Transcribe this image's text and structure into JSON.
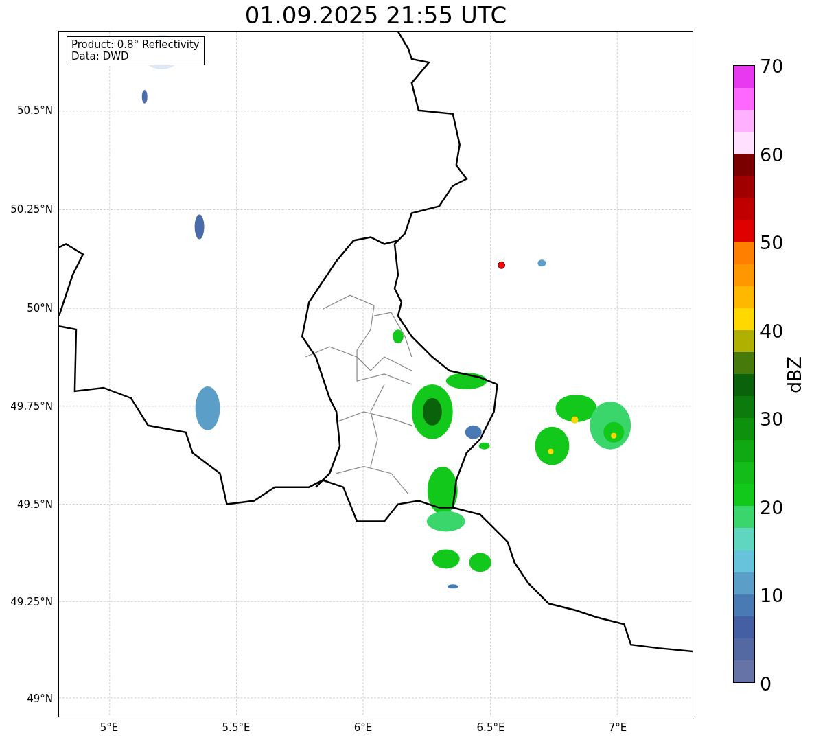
{
  "title": "01.09.2025 21:55 UTC",
  "info_box": {
    "lines": [
      "Product: 0.8° Reflectivity",
      "Data: DWD"
    ]
  },
  "map": {
    "xticks": [
      "5°E",
      "5.5°E",
      "6°E",
      "6.5°E",
      "7°E"
    ],
    "yticks": [
      "50.5°N",
      "50.25°N",
      "50°N",
      "49.75°N",
      "49.5°N",
      "49.25°N",
      "49°N"
    ]
  },
  "colorbar": {
    "label": "dBZ",
    "ticks": [
      "70",
      "60",
      "50",
      "40",
      "30",
      "20",
      "10",
      "0"
    ],
    "segments": [
      {
        "color": "#6673a6"
      },
      {
        "color": "#5468a2"
      },
      {
        "color": "#445fa3"
      },
      {
        "color": "#4a7ab4"
      },
      {
        "color": "#5b9ec8"
      },
      {
        "color": "#67c2dc"
      },
      {
        "color": "#60d6c0"
      },
      {
        "color": "#3ad66c"
      },
      {
        "color": "#12c81a"
      },
      {
        "color": "#13bc18"
      },
      {
        "color": "#10a813"
      },
      {
        "color": "#0e920e"
      },
      {
        "color": "#0c7a0c"
      },
      {
        "color": "#0a620a"
      },
      {
        "color": "#467a0a"
      },
      {
        "color": "#b0b000"
      },
      {
        "color": "#ffd800"
      },
      {
        "color": "#ffb800"
      },
      {
        "color": "#ff9800"
      },
      {
        "color": "#ff8000"
      },
      {
        "color": "#e00000"
      },
      {
        "color": "#c00000"
      },
      {
        "color": "#a00000"
      },
      {
        "color": "#7a0000"
      },
      {
        "color": "#ffe0ff"
      },
      {
        "color": "#ffb0ff"
      },
      {
        "color": "#ff68ff"
      },
      {
        "color": "#e838f0"
      }
    ]
  }
}
